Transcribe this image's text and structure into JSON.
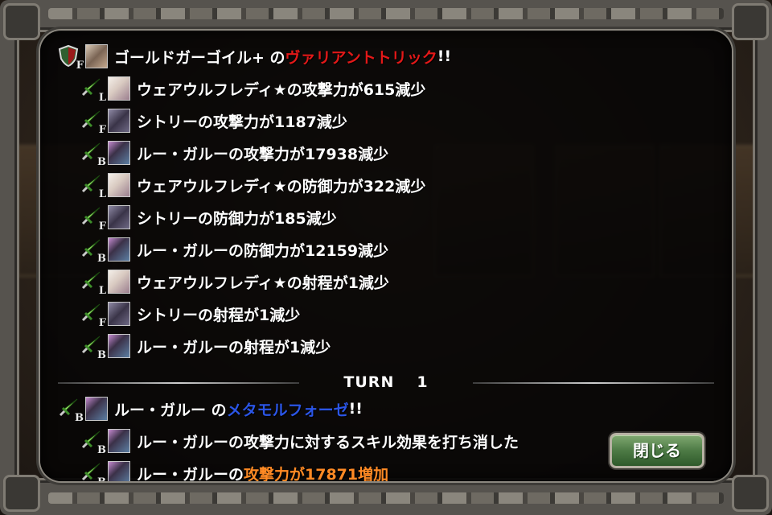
{
  "colors": {
    "highlight_red": "#e21818",
    "highlight_blue": "#2b55e6",
    "highlight_orange": "#ff8a24",
    "button_green": "#4d7a45"
  },
  "log": {
    "entries": [
      {
        "type_icon": "shield-icon",
        "type_letter": "F",
        "portrait": "gargoyle-portrait",
        "text_before": "ゴールドガーゴイル+ の ",
        "highlight": "ヴァリアントトリック",
        "highlight_color": "red",
        "text_after": "!!"
      },
      {
        "type_icon": "sword-icon",
        "type_letter": "L",
        "portrait": "werewolf-portrait",
        "text": "ウェアウルフレディ★の攻撃力が615減少"
      },
      {
        "type_icon": "sword-icon",
        "type_letter": "F",
        "portrait": "sitry-portrait",
        "text": "シトリーの攻撃力が1187減少"
      },
      {
        "type_icon": "sword-icon",
        "type_letter": "B",
        "portrait": "garou-portrait",
        "text": "ルー・ガルーの攻撃力が17938減少"
      },
      {
        "type_icon": "sword-icon",
        "type_letter": "L",
        "portrait": "werewolf-portrait",
        "text": "ウェアウルフレディ★の防御力が322減少"
      },
      {
        "type_icon": "sword-icon",
        "type_letter": "F",
        "portrait": "sitry-portrait",
        "text": "シトリーの防御力が185減少"
      },
      {
        "type_icon": "sword-icon",
        "type_letter": "B",
        "portrait": "garou-portrait",
        "text": "ルー・ガルーの防御力が12159減少"
      },
      {
        "type_icon": "sword-icon",
        "type_letter": "L",
        "portrait": "werewolf-portrait",
        "text": "ウェアウルフレディ★の射程が1減少"
      },
      {
        "type_icon": "sword-icon",
        "type_letter": "F",
        "portrait": "sitry-portrait",
        "text": "シトリーの射程が1減少"
      },
      {
        "type_icon": "sword-icon",
        "type_letter": "B",
        "portrait": "garou-portrait",
        "text": "ルー・ガルーの射程が1減少"
      }
    ],
    "turn_label": "TURN",
    "turn_number": "1",
    "after_turn": [
      {
        "type_icon": "sword-icon",
        "type_letter": "B",
        "portrait": "garou-portrait",
        "text_before": "ルー・ガルー の ",
        "highlight": "メタモルフォーゼ",
        "highlight_color": "blue",
        "text_after": "!!"
      },
      {
        "type_icon": "sword-icon",
        "type_letter": "B",
        "portrait": "garou-portrait",
        "text": "ルー・ガルーの攻撃力に対するスキル効果を打ち消した"
      },
      {
        "type_icon": "sword-icon",
        "type_letter": "B",
        "portrait": "garou-portrait",
        "text_before": "ルー・ガルーの",
        "highlight": "攻撃力が17871増加",
        "highlight_color": "orange",
        "text_after": ""
      }
    ]
  },
  "close_button": {
    "label": "閉じる"
  }
}
